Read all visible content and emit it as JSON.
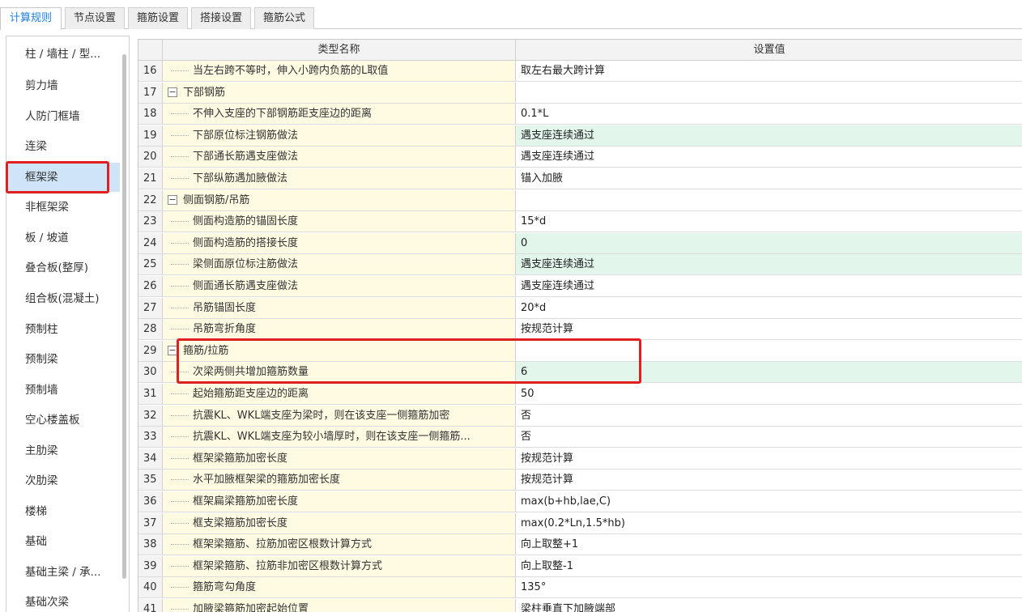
{
  "tabs": [
    {
      "label": "计算规则",
      "active": true
    },
    {
      "label": "节点设置",
      "active": false
    },
    {
      "label": "箍筋设置",
      "active": false
    },
    {
      "label": "搭接设置",
      "active": false
    },
    {
      "label": "箍筋公式",
      "active": false
    }
  ],
  "sidebar": {
    "selected": "框架梁",
    "items": [
      {
        "label": "柱 / 墙柱 / 型..."
      },
      {
        "label": "剪力墙"
      },
      {
        "label": "人防门框墙"
      },
      {
        "label": "连梁"
      },
      {
        "label": "框架梁"
      },
      {
        "label": "非框架梁"
      },
      {
        "label": "板 / 坡道"
      },
      {
        "label": "叠合板(整厚)"
      },
      {
        "label": "组合板(混凝土)"
      },
      {
        "label": "预制柱"
      },
      {
        "label": "预制梁"
      },
      {
        "label": "预制墙"
      },
      {
        "label": "空心楼盖板"
      },
      {
        "label": "主肋梁"
      },
      {
        "label": "次肋梁"
      },
      {
        "label": "楼梯"
      },
      {
        "label": "基础"
      },
      {
        "label": "基础主梁 / 承..."
      },
      {
        "label": "基础次梁"
      }
    ]
  },
  "grid": {
    "columns": {
      "name": "类型名称",
      "value": "设置值"
    },
    "rows": [
      {
        "num": "16",
        "name": "当左右跨不等时，伸入小跨内负筋的L取值",
        "value": "取左右最大跨计算",
        "group": false,
        "highlight": false
      },
      {
        "num": "17",
        "name": "下部钢筋",
        "value": "",
        "group": true,
        "highlight": false
      },
      {
        "num": "18",
        "name": "不伸入支座的下部钢筋距支座边的距离",
        "value": "0.1*L",
        "group": false,
        "highlight": false
      },
      {
        "num": "19",
        "name": "下部原位标注钢筋做法",
        "value": "遇支座连续通过",
        "group": false,
        "highlight": true
      },
      {
        "num": "20",
        "name": "下部通长筋遇支座做法",
        "value": "遇支座连续通过",
        "group": false,
        "highlight": false
      },
      {
        "num": "21",
        "name": "下部纵筋遇加腋做法",
        "value": "锚入加腋",
        "group": false,
        "highlight": false
      },
      {
        "num": "22",
        "name": "侧面钢筋/吊筋",
        "value": "",
        "group": true,
        "highlight": false
      },
      {
        "num": "23",
        "name": "侧面构造筋的锚固长度",
        "value": "15*d",
        "group": false,
        "highlight": false
      },
      {
        "num": "24",
        "name": "侧面构造筋的搭接长度",
        "value": "0",
        "group": false,
        "highlight": true
      },
      {
        "num": "25",
        "name": "梁侧面原位标注筋做法",
        "value": "遇支座连续通过",
        "group": false,
        "highlight": true
      },
      {
        "num": "26",
        "name": "侧面通长筋遇支座做法",
        "value": "遇支座连续通过",
        "group": false,
        "highlight": false
      },
      {
        "num": "27",
        "name": "吊筋锚固长度",
        "value": "20*d",
        "group": false,
        "highlight": false
      },
      {
        "num": "28",
        "name": "吊筋弯折角度",
        "value": "按规范计算",
        "group": false,
        "highlight": false
      },
      {
        "num": "29",
        "name": "箍筋/拉筋",
        "value": "",
        "group": true,
        "highlight": false
      },
      {
        "num": "30",
        "name": "次梁两侧共增加箍筋数量",
        "value": "6",
        "group": false,
        "highlight": true
      },
      {
        "num": "31",
        "name": "起始箍筋距支座边的距离",
        "value": "50",
        "group": false,
        "highlight": false
      },
      {
        "num": "32",
        "name": "抗震KL、WKL端支座为梁时，则在该支座一侧箍筋加密",
        "value": "否",
        "group": false,
        "highlight": false
      },
      {
        "num": "33",
        "name": "抗震KL、WKL端支座为较小墙厚时，则在该支座一侧箍筋...",
        "value": "否",
        "group": false,
        "highlight": false
      },
      {
        "num": "34",
        "name": "框架梁箍筋加密长度",
        "value": "按规范计算",
        "group": false,
        "highlight": false
      },
      {
        "num": "35",
        "name": "水平加腋框架梁的箍筋加密长度",
        "value": "按规范计算",
        "group": false,
        "highlight": false
      },
      {
        "num": "36",
        "name": "框架扁梁箍筋加密长度",
        "value": "max(b+hb,lae,C)",
        "group": false,
        "highlight": false
      },
      {
        "num": "37",
        "name": "框支梁箍筋加密长度",
        "value": "max(0.2*Ln,1.5*hb)",
        "group": false,
        "highlight": false
      },
      {
        "num": "38",
        "name": "框架梁箍筋、拉筋加密区根数计算方式",
        "value": "向上取整+1",
        "group": false,
        "highlight": false
      },
      {
        "num": "39",
        "name": "框架梁箍筋、拉筋非加密区根数计算方式",
        "value": "向上取整-1",
        "group": false,
        "highlight": false
      },
      {
        "num": "40",
        "name": "箍筋弯勾角度",
        "value": "135°",
        "group": false,
        "highlight": false
      },
      {
        "num": "41",
        "name": "加腋梁箍筋加密起始位置",
        "value": "梁柱垂直下加腋端部",
        "group": false,
        "highlight": false
      }
    ]
  },
  "colors": {
    "accent": "#1e7fe0",
    "selected_row": "#cfe4f6",
    "value_highlight": "#e2f6ec",
    "name_background": "#fffbe3",
    "annotation_red": "#e02020"
  }
}
